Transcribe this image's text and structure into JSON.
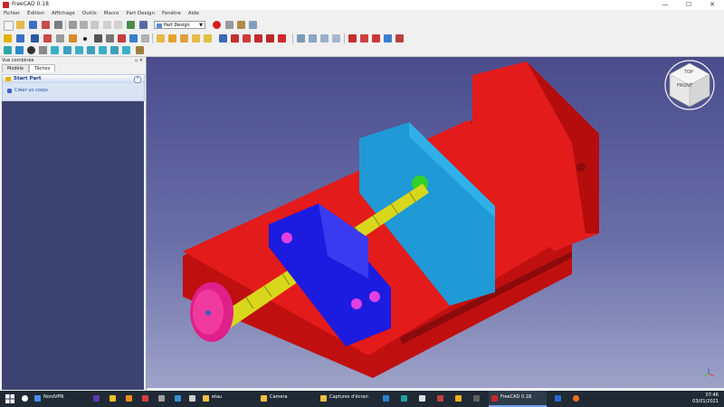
{
  "window": {
    "title": "FreeCAD 0.18",
    "minimize": "—",
    "maximize": "☐",
    "close": "✕"
  },
  "menu": [
    "Fichier",
    "Édition",
    "Affichage",
    "Outils",
    "Macro",
    "Part Design",
    "Fenêtre",
    "Aide"
  ],
  "toolbar": {
    "workbench": "Part Design"
  },
  "combo_view": {
    "title": "Vue combinée",
    "tabs": [
      "Modèle",
      "Tâches"
    ],
    "active_tab": "Tâches",
    "task": {
      "header": "Start Part",
      "action": "Créer un corps"
    }
  },
  "navcube": {
    "front": "FRONT",
    "top": "TOP"
  },
  "colors": {
    "body_red": "#e31b1b",
    "jaw_blue": "#1f9ad6",
    "clamp_blue": "#1c1ce0",
    "screw_yellow": "#d8d71c",
    "knob_pink": "#e0208a",
    "viewport_top": "#4a4c8c",
    "viewport_bottom": "#9ea3c8"
  },
  "taskbar": {
    "apps": [
      {
        "label": "NordVPN",
        "icon": "nordvpn-icon"
      },
      {
        "label": "etau",
        "icon": "folder-icon"
      },
      {
        "label": "Camera",
        "icon": "folder-icon"
      },
      {
        "label": "Captures d'écran",
        "icon": "folder-icon"
      },
      {
        "label": "FreeCAD 0.18",
        "icon": "freecad-icon"
      }
    ],
    "time": "07:46",
    "date": "03/01/2021"
  }
}
